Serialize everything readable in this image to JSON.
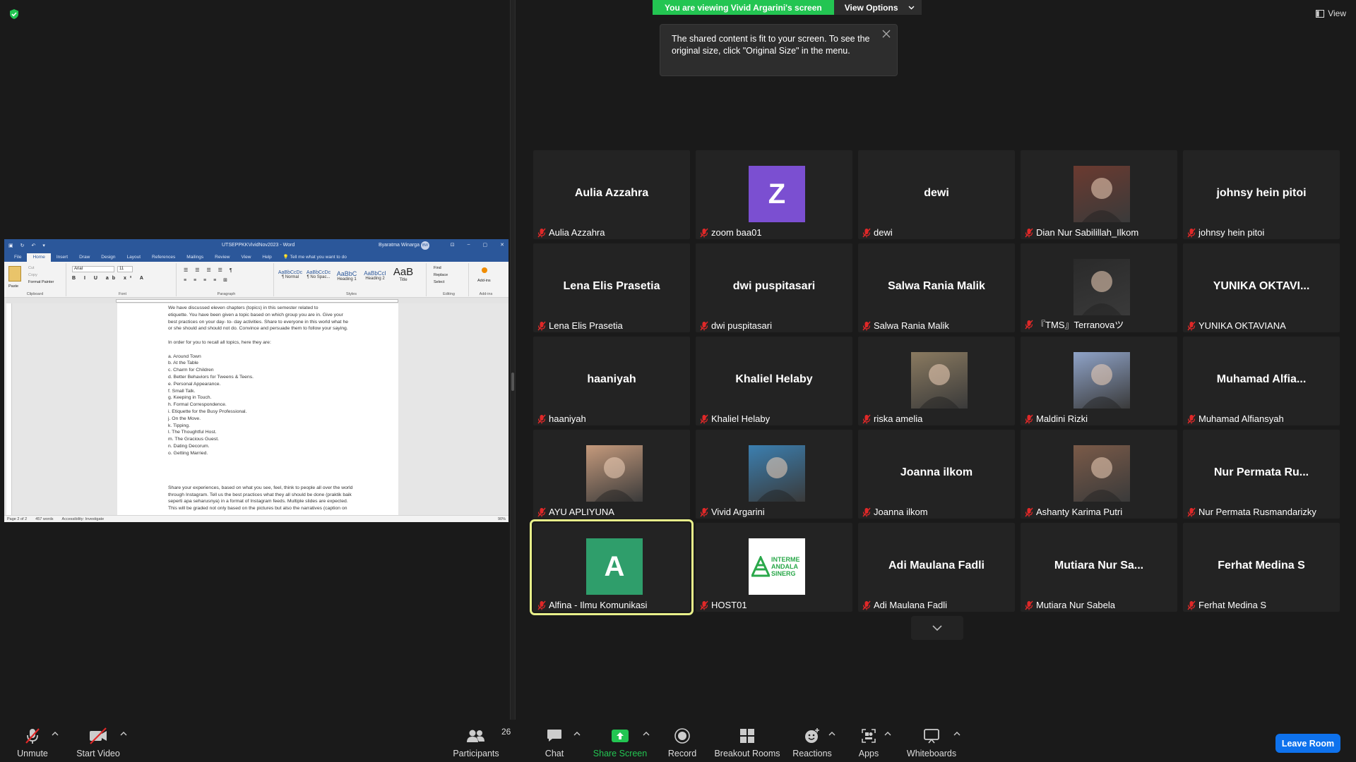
{
  "banner": {
    "viewing": "You are viewing Vivid Argarini's screen",
    "options": "View Options"
  },
  "tooltip": {
    "text": "The shared content is fit to your screen. To see the original size, click \"Original Size\" in the menu."
  },
  "view_label": "View",
  "word": {
    "title": "UTSEPPKKVividNov2023 - Word",
    "user": "Byaratma Winarga",
    "user_initials": "BW",
    "tabs": [
      "File",
      "Home",
      "Insert",
      "Draw",
      "Design",
      "Layout",
      "References",
      "Mailings",
      "Review",
      "View",
      "Help"
    ],
    "tell_me": "Tell me what you want to do",
    "ribbon": {
      "paste": "Paste",
      "cut": "Cut",
      "copy": "Copy",
      "format_painter": "Format Painter",
      "font_name": "Arial",
      "font_size": "11",
      "styles": [
        {
          "sample": "AaBbCcDc",
          "name": "¶ Normal"
        },
        {
          "sample": "AaBbCcDc",
          "name": "¶ No Spac..."
        },
        {
          "sample": "AaBbC",
          "name": "Heading 1"
        },
        {
          "sample": "AaBbCcI",
          "name": "Heading 2"
        },
        {
          "sample": "AaB",
          "name": "Title"
        }
      ],
      "find": "Find",
      "replace": "Replace",
      "select": "Select",
      "addins": "Add-ins",
      "groups": [
        "Clipboard",
        "Font",
        "Paragraph",
        "Styles",
        "Editing",
        "Add-ins"
      ]
    },
    "doc_lines": [
      "We have discussed eleven chapters (topics) in this semester related to",
      "etiquette. You have been given a topic based on which group you are in. Give your",
      "best practices on your day- to- day activities. Share to everyone in this world what he",
      "or she should and should not do. Convince and persuade them to follow your saying.",
      "",
      "In order for you to recall all topics, here they are:",
      "",
      "a. Around Town",
      "b. At the Table",
      "c. Charm for Children",
      "d. Better Behaviors for Tweens & Teens.",
      "e. Personal Appearance.",
      "f.  Small Talk.",
      "g. Keeping in Touch.",
      "h. Formal Correspondence.",
      "i.  Etiquette for the Busy Professional.",
      "j.  On the Move.",
      "k. Tipping.",
      "l. The Thoughtful Host.",
      "m. The Gracious Guest.",
      "n. Dating Decorum.",
      "o. Getting Married.",
      "",
      "",
      "",
      "",
      "Share your experiences, based on what you see, feel, think to people all over the world",
      "through Instagram. Tell us the best practices what they all should be done (praktik baik",
      "seperti apa seharusnya) in a format of Instagram feeds. Multiple slides are expected.",
      "This will be graded not only based on the pictures but also the narratives (caption on"
    ],
    "status": {
      "page": "Page 2 of 2",
      "words": "457 words",
      "accessibility": "Accessibility: Investigate",
      "zoom": "90%"
    }
  },
  "participants": [
    {
      "display": "Aulia Azzahra",
      "name": "Aulia Azzahra",
      "avatar": "none"
    },
    {
      "display": "",
      "name": "zoom baa01",
      "avatar": "letter",
      "letter": "Z",
      "color": "#7b4fd1"
    },
    {
      "display": "dewi",
      "name": "dewi",
      "avatar": "none"
    },
    {
      "display": "",
      "name": "Dian Nur Sabilillah_Ilkom",
      "avatar": "photo",
      "color": "#6b3a30"
    },
    {
      "display": "johnsy hein pitoi",
      "name": "johnsy hein pitoi",
      "avatar": "none"
    },
    {
      "display": "Lena Elis Prasetia",
      "name": "Lena Elis Prasetia",
      "avatar": "none"
    },
    {
      "display": "dwi puspitasari",
      "name": "dwi puspitasari",
      "avatar": "none"
    },
    {
      "display": "Salwa Rania Malik",
      "name": "Salwa Rania Malik",
      "avatar": "none"
    },
    {
      "display": "",
      "name": "『TMS』Terranovaツ",
      "avatar": "photo",
      "color": "#2a2a2a"
    },
    {
      "display": "YUNIKA OKTAVI...",
      "name": "YUNIKA OKTAVIANA",
      "avatar": "none"
    },
    {
      "display": "haaniyah",
      "name": "haaniyah",
      "avatar": "none"
    },
    {
      "display": "Khaliel Helaby",
      "name": "Khaliel Helaby",
      "avatar": "none"
    },
    {
      "display": "",
      "name": "riska amelia",
      "avatar": "photo",
      "color": "#8a7a60"
    },
    {
      "display": "",
      "name": "Maldini Rizki",
      "avatar": "photo",
      "color": "#8fa3c8"
    },
    {
      "display": "Muhamad  Alfia...",
      "name": "Muhamad Alfiansyah",
      "avatar": "none"
    },
    {
      "display": "",
      "name": "AYU APLIYUNA",
      "avatar": "photo",
      "color": "#c59a7c"
    },
    {
      "display": "",
      "name": "Vivid Argarini",
      "avatar": "photo",
      "color": "#3b7fb0"
    },
    {
      "display": "Joanna ilkom",
      "name": "Joanna ilkom",
      "avatar": "none"
    },
    {
      "display": "",
      "name": "Ashanty Karima Putri",
      "avatar": "photo",
      "color": "#7a5a48"
    },
    {
      "display": "Nur Permata Ru...",
      "name": "Nur Permata Rusmandarizky",
      "avatar": "none"
    },
    {
      "display": "",
      "name": "Alfina - Ilmu Komunikasi",
      "avatar": "letter",
      "letter": "A",
      "color": "#2f9e6b",
      "active": true
    },
    {
      "display": "",
      "name": "HOST01",
      "avatar": "logo",
      "logo_text": [
        "INTERME",
        "ANDALA",
        "SINERG"
      ]
    },
    {
      "display": "Adi Maulana Fadli",
      "name": "Adi Maulana Fadli",
      "avatar": "none"
    },
    {
      "display": "Mutiara  Nur  Sa...",
      "name": "Mutiara Nur Sabela",
      "avatar": "none"
    },
    {
      "display": "Ferhat Medina S",
      "name": "Ferhat Medina S",
      "avatar": "none"
    }
  ],
  "toolbar": {
    "unmute": "Unmute",
    "start_video": "Start Video",
    "participants": "Participants",
    "participants_count": "26",
    "chat": "Chat",
    "share_screen": "Share Screen",
    "record": "Record",
    "breakout": "Breakout Rooms",
    "reactions": "Reactions",
    "apps": "Apps",
    "whiteboards": "Whiteboards",
    "leave": "Leave Room"
  },
  "colors": {
    "accent_green": "#23c552",
    "leave_blue": "#0e72ed",
    "muted_red": "#e02828",
    "active_outline": "#e8f08a",
    "word_blue": "#2b579a"
  }
}
